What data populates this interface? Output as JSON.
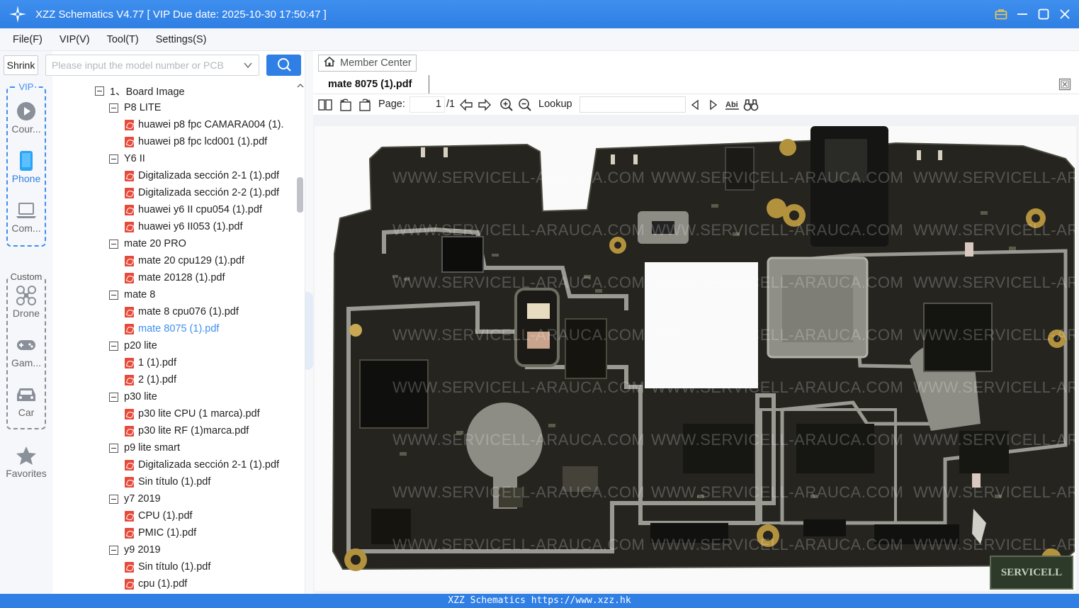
{
  "window": {
    "title": "XZZ Schematics V4.77 [ VIP Due date: 2025-10-30 17:50:47 ]"
  },
  "menu": [
    "File(F)",
    "VIP(V)",
    "Tool(T)",
    "Settings(S)"
  ],
  "left_rail": {
    "shrink_label": "Shrink",
    "vip_label": "VIP",
    "custom_label": "Custom",
    "items": [
      {
        "label": "Cour...",
        "icon": "play-icon"
      },
      {
        "label": "Phone",
        "icon": "phone-icon"
      },
      {
        "label": "Com...",
        "icon": "laptop-icon"
      },
      {
        "label": "Drone",
        "icon": "drone-icon"
      },
      {
        "label": "Gam...",
        "icon": "gamepad-icon"
      },
      {
        "label": "Car",
        "icon": "car-icon"
      },
      {
        "label": "Favorites",
        "icon": "star-icon"
      }
    ]
  },
  "search": {
    "placeholder": "Please input the model number or PCB"
  },
  "tree": [
    {
      "type": "folder",
      "label": "1、Board Image",
      "level": 0
    },
    {
      "type": "folder",
      "label": "P8 LITE",
      "level": 1
    },
    {
      "type": "file",
      "label": "huawei p8 fpc CAMARA004 (1).",
      "level": 2
    },
    {
      "type": "file",
      "label": "huawei p8 fpc lcd001 (1).pdf",
      "level": 2
    },
    {
      "type": "folder",
      "label": "Y6 II",
      "level": 1
    },
    {
      "type": "file",
      "label": "Digitalizada sección 2-1 (1).pdf",
      "level": 2
    },
    {
      "type": "file",
      "label": "Digitalizada sección 2-2 (1).pdf",
      "level": 2
    },
    {
      "type": "file",
      "label": "huawei y6 II cpu054 (1).pdf",
      "level": 2
    },
    {
      "type": "file",
      "label": "huawei y6 II053 (1).pdf",
      "level": 2
    },
    {
      "type": "folder",
      "label": "mate 20 PRO",
      "level": 1
    },
    {
      "type": "file",
      "label": "mate 20 cpu129 (1).pdf",
      "level": 2
    },
    {
      "type": "file",
      "label": "mate 20128 (1).pdf",
      "level": 2
    },
    {
      "type": "folder",
      "label": "mate 8",
      "level": 1
    },
    {
      "type": "file",
      "label": "mate 8 cpu076 (1).pdf",
      "level": 2
    },
    {
      "type": "file",
      "label": "mate 8075 (1).pdf",
      "level": 2,
      "selected": true
    },
    {
      "type": "folder",
      "label": "p20 lite",
      "level": 1
    },
    {
      "type": "file",
      "label": "1 (1).pdf",
      "level": 2
    },
    {
      "type": "file",
      "label": "2 (1).pdf",
      "level": 2
    },
    {
      "type": "folder",
      "label": "p30 lite",
      "level": 1
    },
    {
      "type": "file",
      "label": "p30 lite CPU (1 marca).pdf",
      "level": 2
    },
    {
      "type": "file",
      "label": "p30 lite RF (1)marca.pdf",
      "level": 2
    },
    {
      "type": "folder",
      "label": "p9 lite smart",
      "level": 1
    },
    {
      "type": "file",
      "label": "Digitalizada sección 2-1 (1).pdf",
      "level": 2
    },
    {
      "type": "file",
      "label": "Sin título (1).pdf",
      "level": 2
    },
    {
      "type": "folder",
      "label": "y7 2019",
      "level": 1
    },
    {
      "type": "file",
      "label": "CPU (1).pdf",
      "level": 2
    },
    {
      "type": "file",
      "label": "PMIC (1).pdf",
      "level": 2
    },
    {
      "type": "folder",
      "label": "y9 2019",
      "level": 1
    },
    {
      "type": "file",
      "label": "Sin título (1).pdf",
      "level": 2
    },
    {
      "type": "file",
      "label": "cpu (1).pdf",
      "level": 2
    }
  ],
  "viewer": {
    "member_center_label": "Member Center",
    "active_tab": "mate 8075 (1).pdf",
    "page_label": "Page:",
    "page_current": "1",
    "page_total": "/1",
    "lookup_label": "Lookup",
    "lookup_value": "",
    "watermark": "WWW.SERVICELL-ARAUCA.COM",
    "stamp_text": "SERVICELL"
  },
  "status": {
    "text": "XZZ Schematics https://www.xzz.hk"
  },
  "colors": {
    "accent": "#2f7fe4",
    "pcb": "#25241f",
    "shield": "#9a9a92",
    "pdf_icon": "#e54a3a"
  }
}
